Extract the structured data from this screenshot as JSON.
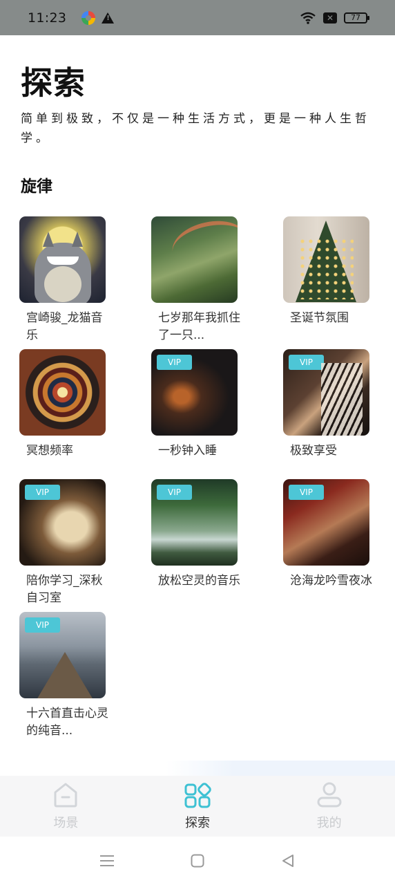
{
  "status_bar": {
    "time": "11:23",
    "battery": "77"
  },
  "header": {
    "title": "探索",
    "subtitle": "简单到极致，不仅是一种生活方式，更是一种人生哲学。"
  },
  "section": {
    "title": "旋律"
  },
  "cards": [
    {
      "title": "宫崎骏_龙猫音乐",
      "vip": false,
      "thumb": "t-totoro"
    },
    {
      "title": "七岁那年我抓住了一只...",
      "vip": false,
      "thumb": "t-forest"
    },
    {
      "title": "圣诞节氛围",
      "vip": false,
      "thumb": "t-tree"
    },
    {
      "title": "冥想频率",
      "vip": false,
      "thumb": "t-spiral"
    },
    {
      "title": "一秒钟入睡",
      "vip": true,
      "thumb": "t-fire"
    },
    {
      "title": "极致享受",
      "vip": true,
      "thumb": "t-piano"
    },
    {
      "title": "陪你学习_深秋自习室",
      "vip": true,
      "thumb": "t-book"
    },
    {
      "title": "放松空灵的音乐",
      "vip": true,
      "thumb": "t-river"
    },
    {
      "title": "沧海龙吟雪夜冰",
      "vip": true,
      "thumb": "t-guzheng"
    },
    {
      "title": "十六首直击心灵的纯音...",
      "vip": true,
      "thumb": "t-pier"
    }
  ],
  "vip_label": "VIP",
  "bottom_nav": {
    "items": [
      {
        "label": "场景",
        "icon": "home-icon",
        "active": false
      },
      {
        "label": "探索",
        "icon": "grid-icon",
        "active": true
      },
      {
        "label": "我的",
        "icon": "user-icon",
        "active": false
      }
    ]
  },
  "colors": {
    "accent": "#4dc6d6",
    "status_bar": "#868b8a"
  }
}
